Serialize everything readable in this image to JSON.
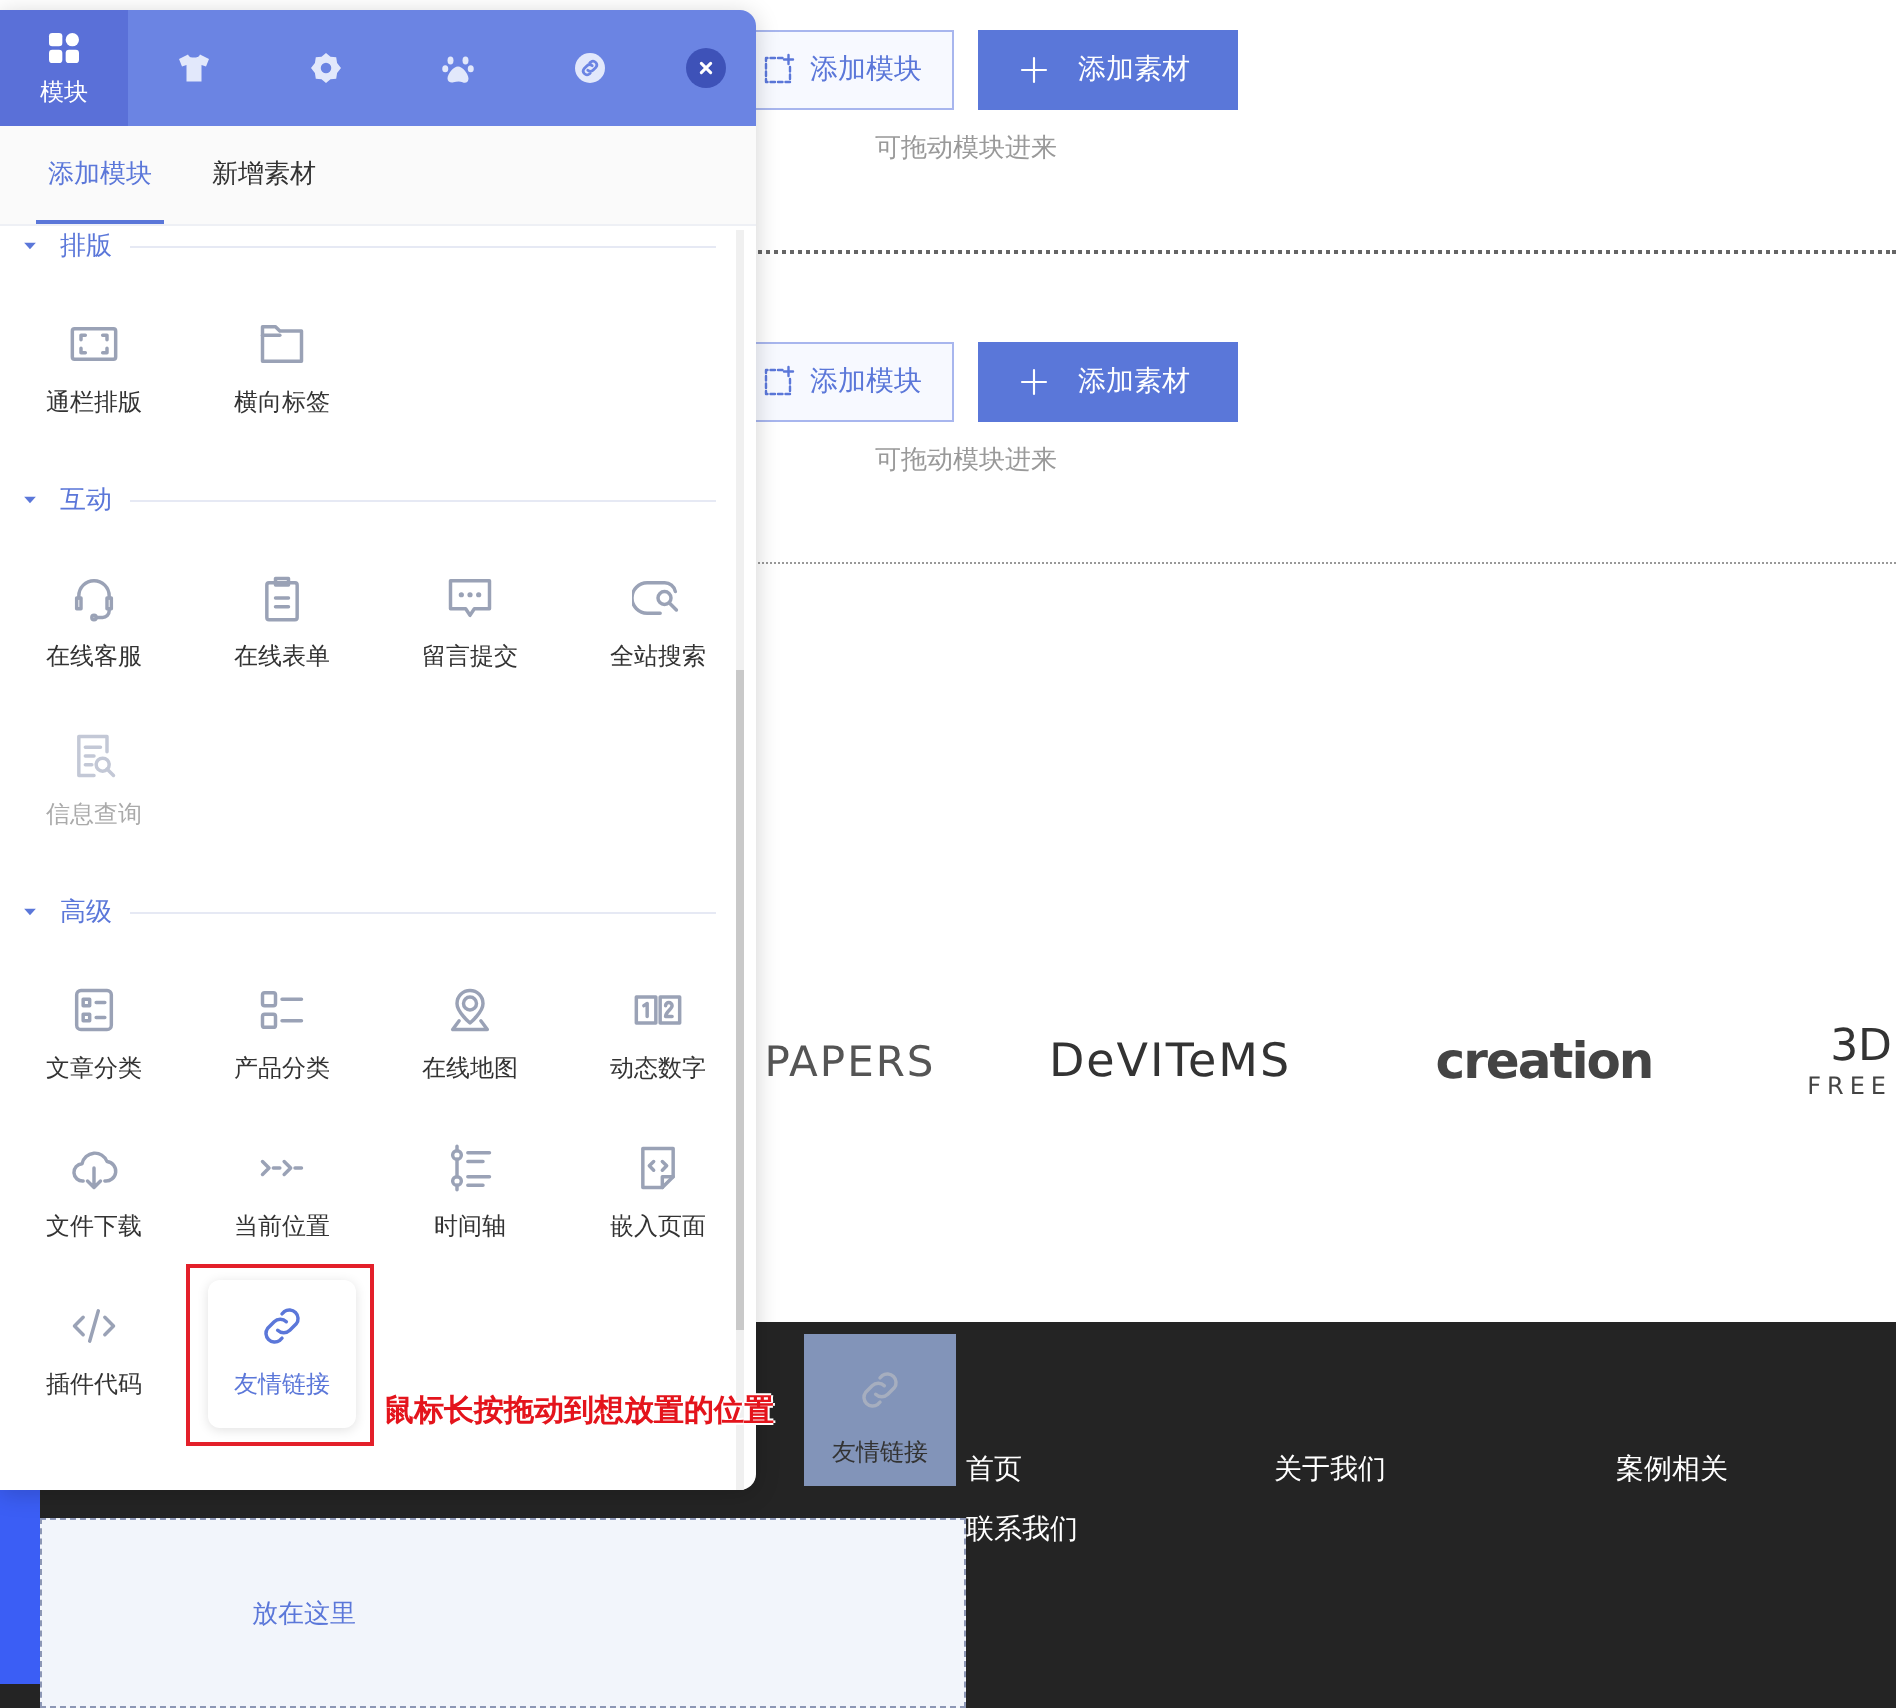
{
  "page": {
    "sections": [
      {
        "buttons": [
          {
            "label": "添加模块",
            "kind": "outline"
          },
          {
            "label": "添加素材",
            "kind": "filled"
          }
        ],
        "hint": "可拖动模块进来"
      },
      {
        "buttons": [
          {
            "label": "添加模块",
            "kind": "outline"
          },
          {
            "label": "添加素材",
            "kind": "filled"
          }
        ],
        "hint": "可拖动模块进来"
      }
    ],
    "logos": [
      {
        "text": "PAPERS"
      },
      {
        "text": "DeVITeMS"
      },
      {
        "text": "creation"
      },
      {
        "text": "3D",
        "subtext": "FREE"
      }
    ],
    "footer": {
      "nav": [
        "首页",
        "关于我们",
        "案例相关",
        "联系我们"
      ],
      "drop_zone": "放在这里"
    }
  },
  "panel": {
    "tabs": [
      {
        "label": "模块",
        "selected": true
      },
      {
        "selected": false
      },
      {
        "selected": false
      },
      {
        "selected": false
      },
      {
        "selected": false
      }
    ],
    "subtabs": [
      {
        "label": "添加模块",
        "selected": true
      },
      {
        "label": "新增素材",
        "selected": false
      }
    ],
    "groups": [
      {
        "title": "排版",
        "expanded": true,
        "items": [
          {
            "label": "通栏排版",
            "disabled": false,
            "selected": false
          },
          {
            "label": "横向标签",
            "disabled": false,
            "selected": false
          }
        ]
      },
      {
        "title": "互动",
        "expanded": true,
        "items": [
          {
            "label": "在线客服",
            "disabled": false,
            "selected": false
          },
          {
            "label": "在线表单",
            "disabled": false,
            "selected": false
          },
          {
            "label": "留言提交",
            "disabled": false,
            "selected": false
          },
          {
            "label": "全站搜索",
            "disabled": false,
            "selected": false
          },
          {
            "label": "信息查询",
            "disabled": true,
            "selected": false
          }
        ]
      },
      {
        "title": "高级",
        "expanded": true,
        "items": [
          {
            "label": "文章分类",
            "disabled": false,
            "selected": false
          },
          {
            "label": "产品分类",
            "disabled": false,
            "selected": false
          },
          {
            "label": "在线地图",
            "disabled": false,
            "selected": false
          },
          {
            "label": "动态数字",
            "disabled": false,
            "selected": false
          },
          {
            "label": "文件下载",
            "disabled": false,
            "selected": false
          },
          {
            "label": "当前位置",
            "disabled": false,
            "selected": false
          },
          {
            "label": "时间轴",
            "disabled": false,
            "selected": false
          },
          {
            "label": "嵌入页面",
            "disabled": false,
            "selected": false
          },
          {
            "label": "插件代码",
            "disabled": false,
            "selected": false
          },
          {
            "label": "友情链接",
            "disabled": false,
            "selected": true
          }
        ]
      }
    ]
  },
  "drag_ghost": {
    "label": "友情链接"
  },
  "hint_tooltip": "鼠标长按拖动到想放置的位置"
}
